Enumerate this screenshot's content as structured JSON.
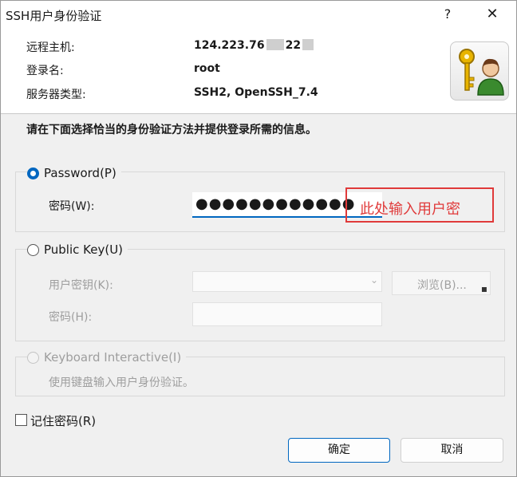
{
  "window": {
    "title": "SSH用户身份验证",
    "help": "?",
    "close": "✕"
  },
  "info": {
    "host_label": "远程主机:",
    "host_value_a": "124.223.76",
    "host_value_b": "22",
    "user_label": "登录名:",
    "user_value": "root",
    "server_label": "服务器类型:",
    "server_value": "SSH2, OpenSSH_7.4",
    "icon": "key-user-icon"
  },
  "instruction": "请在下面选择恰当的身份验证方法并提供登录所需的信息。",
  "password_group": {
    "option_label": "Password(P)",
    "field_label": "密码(W):",
    "value": "●●●●●●●●●●●●",
    "annotation": "此处输入用户密",
    "annotation_color": "#e03a3a"
  },
  "publickey_group": {
    "option_label": "Public Key(U)",
    "key_label": "用户密钥(K):",
    "browse_label": "浏览(B)...",
    "passphrase_label": "密码(H):"
  },
  "keyboard_group": {
    "option_label": "Keyboard Interactive(I)",
    "description": "使用键盘输入用户身份验证。"
  },
  "remember_label": "记住密码(R)",
  "buttons": {
    "ok": "确定",
    "cancel": "取消"
  },
  "colors": {
    "accent": "#0067c0"
  }
}
